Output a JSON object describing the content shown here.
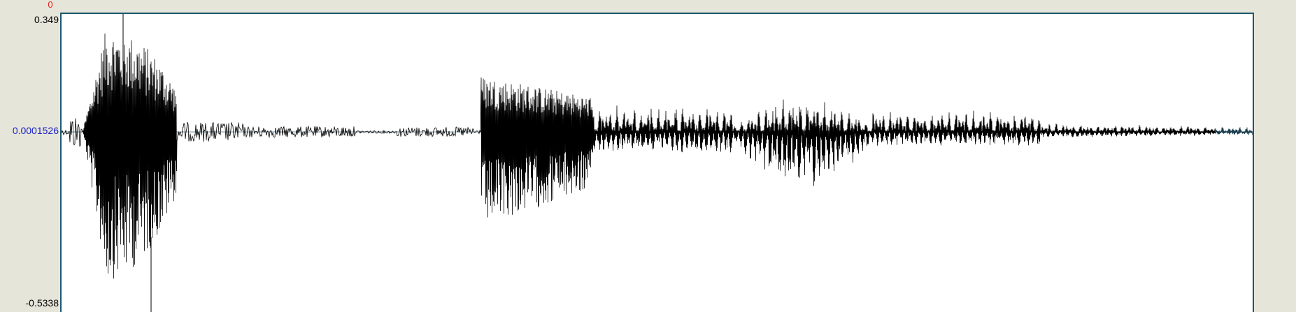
{
  "waveform_view": {
    "time_cursor_label": "0",
    "amplitude_max_label": "0.349",
    "amplitude_center_label": "0.0001526",
    "amplitude_min_label": "-0.5338"
  },
  "colors": {
    "background": "#e6e5da",
    "plot_background": "#ffffff",
    "plot_border": "#1c5870",
    "waveform": "#000000",
    "tail_waveform": "#1a3d4e",
    "center_label": "#1a22c9",
    "cursor_label": "#e2231a"
  },
  "chart_data": {
    "type": "line",
    "ylim": [
      -0.5338,
      0.349
    ],
    "center_value": 0.0001526
  }
}
